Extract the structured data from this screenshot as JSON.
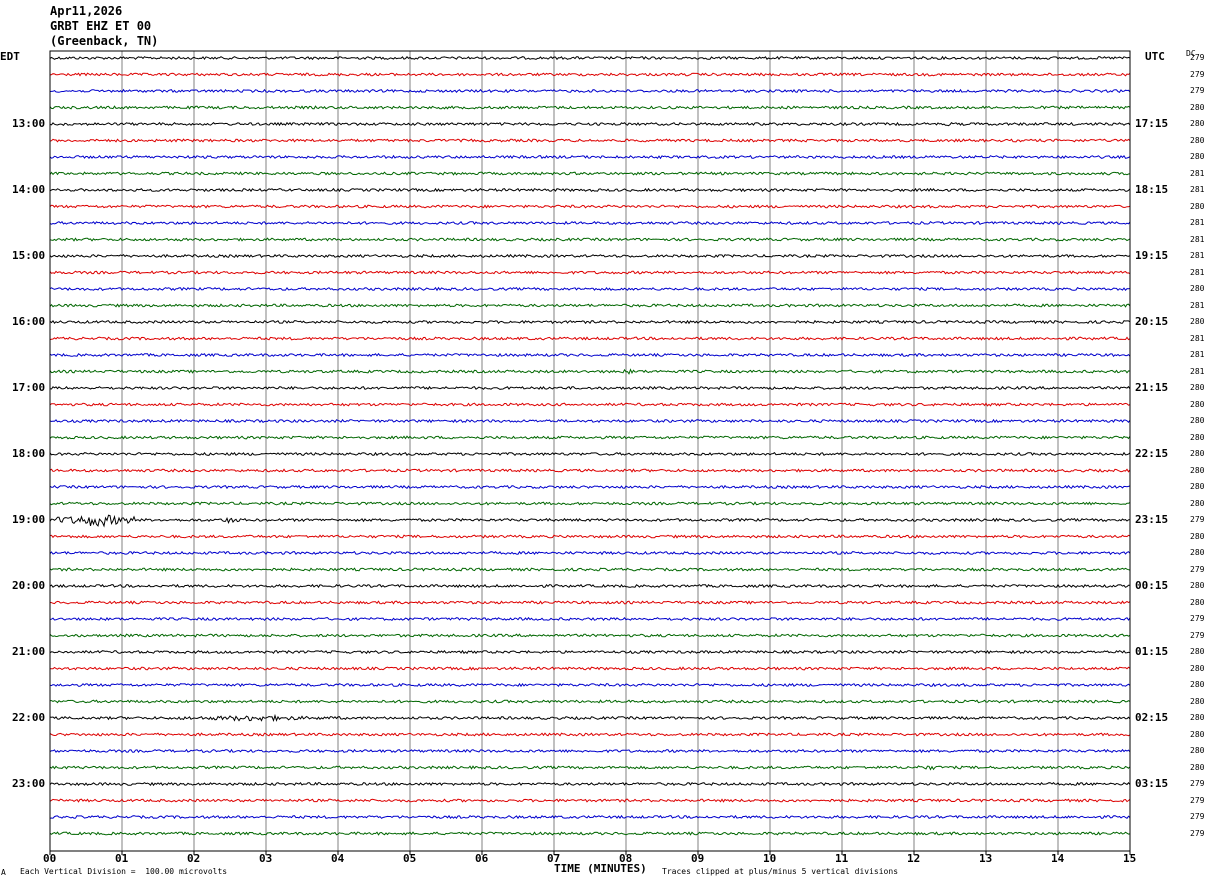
{
  "header": {
    "date": "Apr11,2026",
    "station": "GRBT EHZ ET 00",
    "location": "(Greenback, TN)"
  },
  "labels": {
    "left_tz": "EDT",
    "right_tz": "UTC",
    "dc_header": "DC"
  },
  "footer": {
    "scale_note": "Each Vertical Division =  100.00 microvolts",
    "clip_note": "Traces clipped at plus/minus 5 vertical divisions",
    "corner_mark": "A"
  },
  "colors": {
    "trace_cycle": [
      "#000000",
      "#dd0000",
      "#0000cc",
      "#006600"
    ],
    "grid": "#808080"
  },
  "chart_data": {
    "type": "line",
    "title": "Apr11,2026 GRBT EHZ ET 00 (Greenback, TN)",
    "xlabel": "TIME (MINUTES)",
    "xlim": [
      0,
      15
    ],
    "x_ticks": [
      "00",
      "01",
      "02",
      "03",
      "04",
      "05",
      "06",
      "07",
      "08",
      "09",
      "10",
      "11",
      "12",
      "13",
      "14",
      "15"
    ],
    "rows_per_hour": 4,
    "minutes_per_row": 15,
    "row_count": 48,
    "left_hour_labels": [
      "13:00",
      "14:00",
      "15:00",
      "16:00",
      "17:00",
      "18:00",
      "19:00",
      "20:00",
      "21:00",
      "22:00",
      "23:00"
    ],
    "right_hour_labels": [
      "17:15",
      "18:15",
      "19:15",
      "20:15",
      "21:15",
      "22:15",
      "23:15",
      "00:15",
      "01:15",
      "02:15",
      "03:15"
    ],
    "dc_offsets": [
      279,
      279,
      279,
      280,
      280,
      280,
      280,
      281,
      281,
      280,
      281,
      281,
      281,
      281,
      280,
      281,
      280,
      281,
      281,
      281,
      280,
      280,
      280,
      280,
      280,
      280,
      280,
      280,
      279,
      280,
      280,
      279,
      280,
      280,
      279,
      279,
      280,
      280,
      280,
      280,
      280,
      280,
      280,
      280,
      279,
      279,
      279,
      279
    ],
    "events": [
      {
        "row": 28,
        "start_min": 0.1,
        "end_min": 1.2,
        "amplitude": "large",
        "note": "local event burst"
      },
      {
        "row": 28,
        "start_min": 2.3,
        "end_min": 2.7,
        "amplitude": "medium"
      },
      {
        "row": 40,
        "start_min": 1.7,
        "end_min": 4.0,
        "amplitude": "medium",
        "note": "elevated noise"
      },
      {
        "row": 4,
        "start_min": 12.4,
        "end_min": 12.6,
        "amplitude": "small"
      },
      {
        "row": 19,
        "start_min": 7.8,
        "end_min": 8.3,
        "amplitude": "small"
      },
      {
        "row": 43,
        "start_min": 11.8,
        "end_min": 12.6,
        "amplitude": "small"
      }
    ]
  }
}
